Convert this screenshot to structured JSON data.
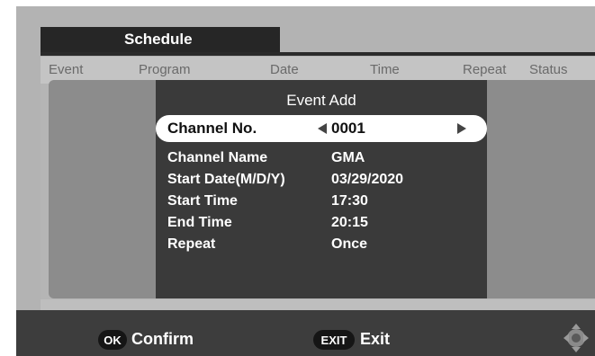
{
  "tab": {
    "title": "Schedule"
  },
  "columns": [
    "Event",
    "Program",
    "Date",
    "Time",
    "Repeat",
    "Status"
  ],
  "dialog": {
    "title": "Event Add",
    "channel": {
      "label": "Channel No.",
      "value": "0001"
    },
    "fields": [
      {
        "label": "Channel Name",
        "value": "GMA"
      },
      {
        "label": "Start Date(M/D/Y)",
        "value": "03/29/2020"
      },
      {
        "label": "Start Time",
        "value": "17:30"
      },
      {
        "label": "End Time",
        "value": "20:15"
      },
      {
        "label": "Repeat",
        "value": "Once"
      }
    ]
  },
  "footer": {
    "ok_key": "OK",
    "ok_label": "Confirm",
    "exit_key": "EXIT",
    "exit_label": "Exit",
    "nav_icon": "dpad-icon"
  }
}
